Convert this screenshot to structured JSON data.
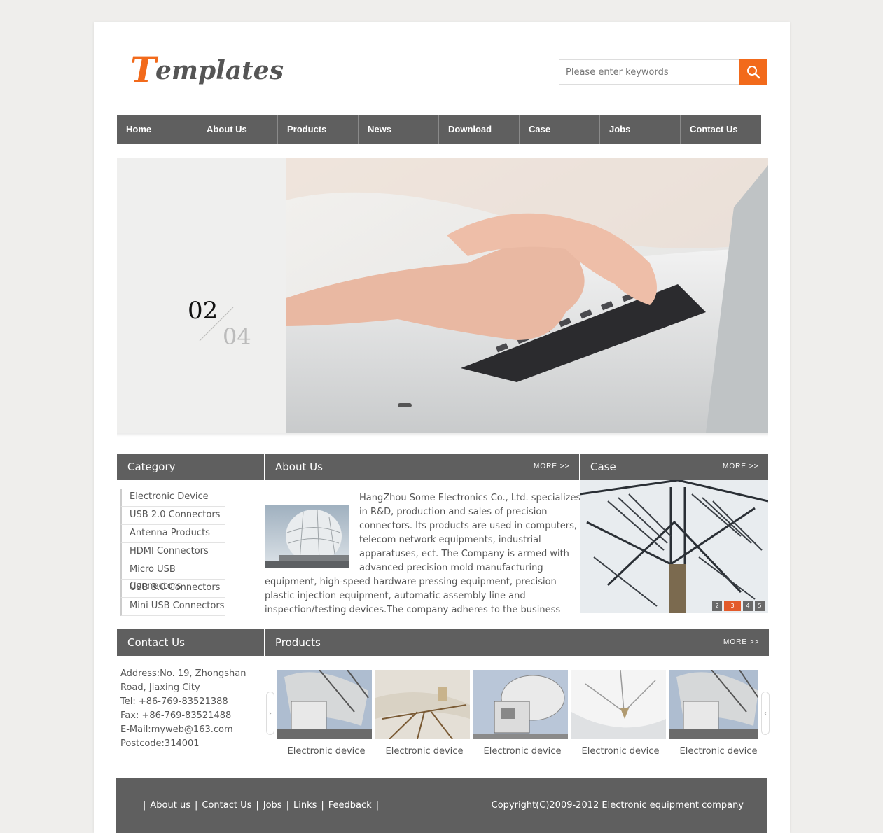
{
  "brand": {
    "logo_first": "T",
    "logo_rest": "emplates",
    "accent": "#f26a1b",
    "dark": "#5f5f5f"
  },
  "search": {
    "placeholder": "Please enter keywords",
    "icon": "search-icon"
  },
  "nav": [
    "Home",
    "About Us",
    "Products",
    "News",
    "Download",
    "Case",
    "Jobs",
    "Contact Us"
  ],
  "banner": {
    "current": "02",
    "total": "04"
  },
  "category": {
    "title": "Category",
    "items": [
      "Electronic Device",
      "USB 2.0 Connectors",
      "Antenna Products",
      "HDMI Connectors",
      "Micro USB Connectors",
      "USB 3.0 Connectors",
      "Mini USB Connectors"
    ]
  },
  "about": {
    "title": "About Us",
    "more": "MORE >>",
    "text": "HangZhou Some Electronics Co., Ltd. specializes in R&D, production and sales of precision connectors. Its products are used in computers, telecom network equipments, industrial apparatuses, ect. The Company is armed with advanced precision mold manufacturing equipment, high-speed hardware pressing equipment, precision plastic injection equipment, automatic assembly line and inspection/testing devices.The company adheres to the business principle of technology"
  },
  "case": {
    "title": "Case",
    "more": "MORE >>",
    "dots": [
      "2",
      "3",
      "4",
      "5"
    ]
  },
  "contact": {
    "title": "Contact Us",
    "lines": [
      "Address:No. 19, Zhongshan Road, Jiaxing City",
      "Tel: +86-769-83521388",
      "Fax: +86-769-83521488",
      "E-Mail:myweb@163.com",
      "Postcode:314001"
    ]
  },
  "products": {
    "title": "Products",
    "more": "MORE >>",
    "items": [
      "Electronic device",
      "Electronic device",
      "Electronic device",
      "Electronic device",
      "Electronic device"
    ]
  },
  "footer": {
    "links": [
      "About us",
      "Contact Us",
      "Jobs",
      "Links",
      "Feedback"
    ],
    "copyright": "Copyright(C)2009-2012 Electronic equipment company"
  }
}
